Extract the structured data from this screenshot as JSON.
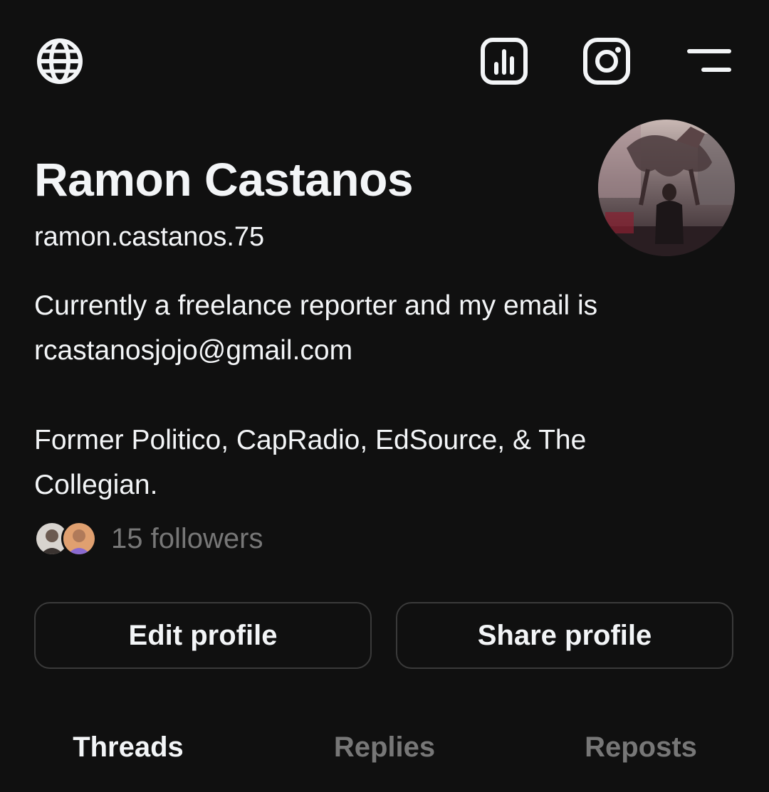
{
  "header": {
    "icons": [
      "globe-icon",
      "insights-icon",
      "instagram-icon",
      "menu-icon"
    ]
  },
  "profile": {
    "name": "Ramon Castanos",
    "handle": "ramon.castanos.75",
    "bio_line1": "Currently a freelance reporter and my email is",
    "bio_line2": "rcastanosjojo@gmail.com",
    "bio_line3": "Former Politico, CapRadio, EdSource, & The",
    "bio_line4": "Collegian.",
    "followers_text": "15 followers"
  },
  "actions": {
    "edit_label": "Edit profile",
    "share_label": "Share profile"
  },
  "tabs": [
    {
      "label": "Threads",
      "active": true
    },
    {
      "label": "Replies",
      "active": false
    },
    {
      "label": "Reposts",
      "active": false
    }
  ],
  "colors": {
    "background": "#101010",
    "text_primary": "#f3f5f7",
    "text_secondary": "#777777",
    "button_border": "#3a3a3a"
  }
}
